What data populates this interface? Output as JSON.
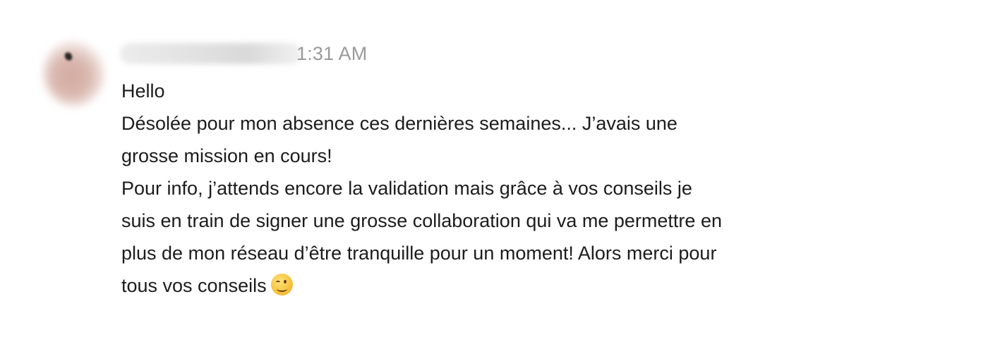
{
  "message": {
    "sender": {
      "name_visible": "",
      "avatar_icon": "user-avatar-blurred"
    },
    "timestamp": "1:31 AM",
    "lines": [
      "Hello",
      "Désolée pour mon absence ces dernières semaines... J’avais une",
      "grosse mission en cours!",
      "Pour info, j’attends encore la validation mais grâce à vos conseils je",
      "suis en train de signer une grosse collaboration qui va me permettre en",
      "plus de mon réseau d’être tranquille pour un moment! Alors merci pour",
      "tous vos conseils"
    ],
    "emoji": "winking-face-emoji"
  },
  "colors": {
    "text": "#1d1c1d",
    "timestamp": "#9a9a9a",
    "background": "#ffffff"
  }
}
